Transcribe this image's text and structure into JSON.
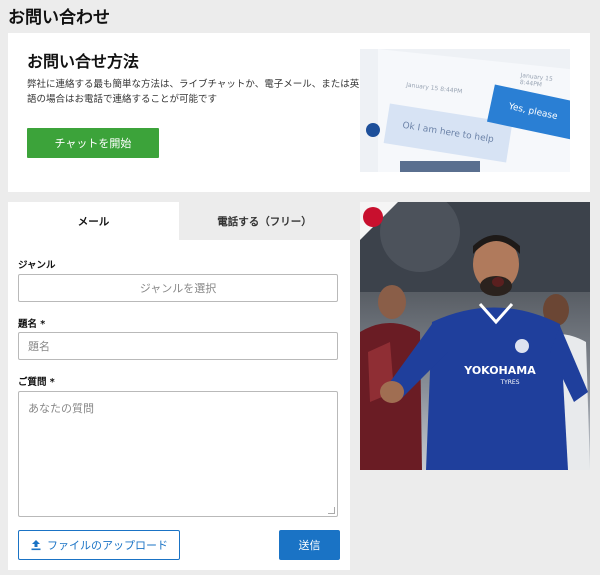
{
  "page": {
    "title": "お問い合わせ"
  },
  "contact_method": {
    "title": "お問い合せ方法",
    "description": "弊社に連絡する最も簡単な方法は、ライブチャットか、電子メール、または英語の場合はお電話で連絡することが可能です",
    "chat_button_label": "チャットを開始",
    "illustration": {
      "date_in": "January 15 8:44PM",
      "date_out": "January 15 8:44PM",
      "incoming_message": "Ok I am here to help",
      "outgoing_message": "Yes, please"
    }
  },
  "form": {
    "tabs": [
      {
        "label": "メール",
        "active": true
      },
      {
        "label": "電話する（フリー）",
        "active": false
      }
    ],
    "genre": {
      "label": "ジャンル",
      "placeholder": "ジャンルを選択"
    },
    "subject": {
      "label": "題名 *",
      "placeholder": "題名"
    },
    "question": {
      "label": "ご質問 *",
      "placeholder": "あなたの質問"
    },
    "upload_button_label": "ファイルのアップロード",
    "send_button_label": "送信"
  },
  "promo": {
    "sponsor_text": "YOKOHAMA",
    "sponsor_sub": "TYRES",
    "colors": {
      "kit_blue": "#1f3f9c",
      "japan_red": "#c8102e"
    }
  }
}
